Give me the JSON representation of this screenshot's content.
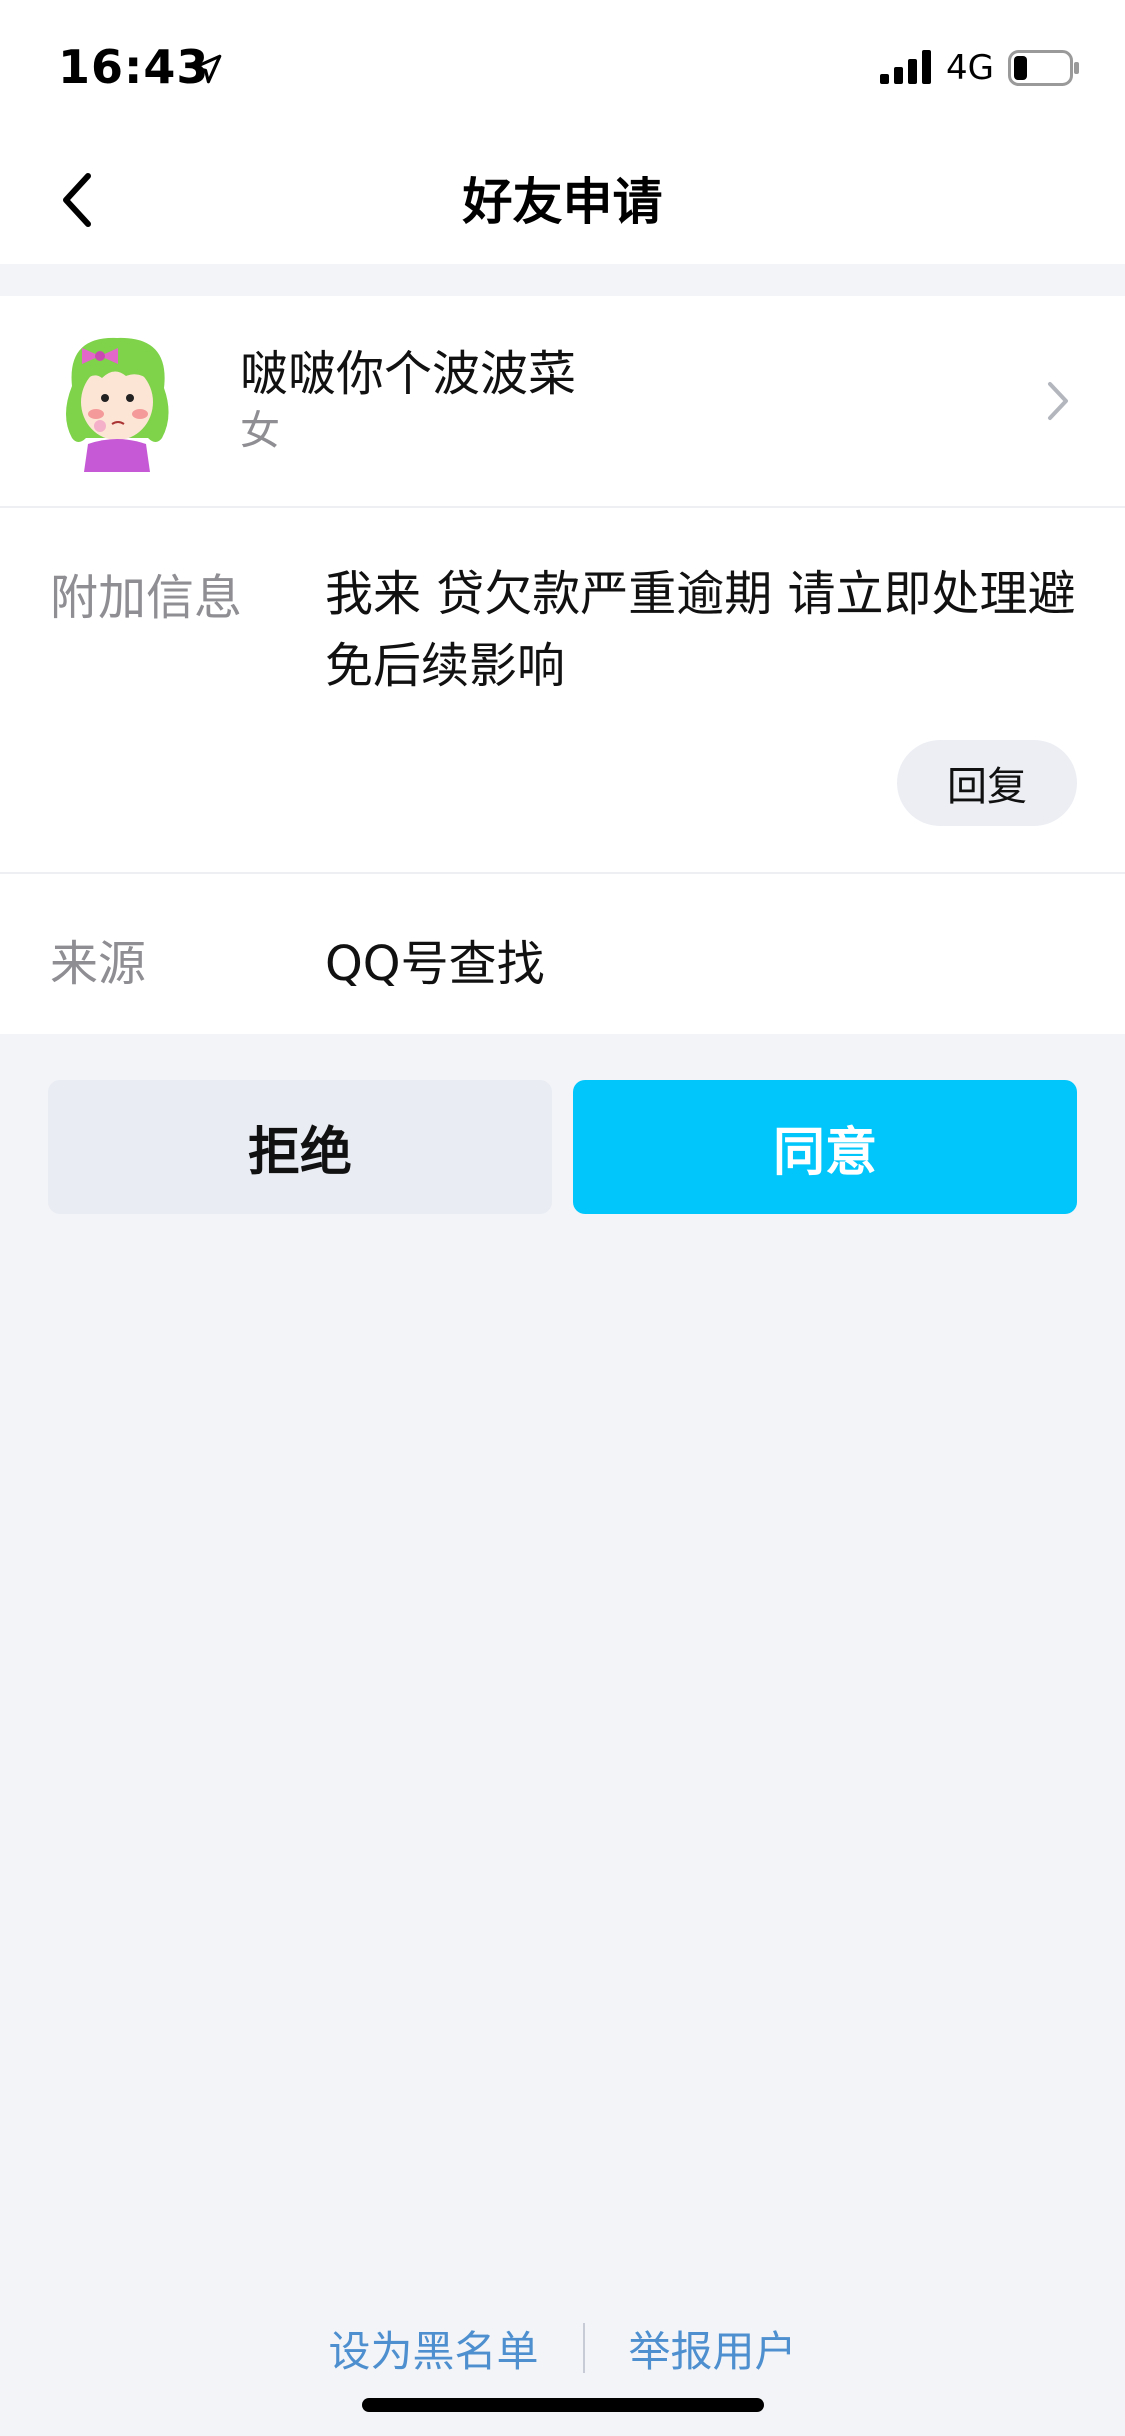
{
  "status_bar": {
    "time": "16:43",
    "network": "4G",
    "battery_level": 0.25
  },
  "nav": {
    "title": "好友申请",
    "back_icon": "chevron-left-icon"
  },
  "profile": {
    "name": "啵啵你个波波菜",
    "gender": "女",
    "avatar_icon": "cartoon-girl-avatar",
    "chevron_icon": "chevron-right-icon"
  },
  "extra_info": {
    "label": "附加信息",
    "message": "我来 贷欠款严重逾期 请立即处理避免后续影响",
    "reply_label": "回复"
  },
  "source": {
    "label": "来源",
    "value": "QQ号查找"
  },
  "actions": {
    "reject_label": "拒绝",
    "accept_label": "同意"
  },
  "footer": {
    "blacklist_label": "设为黑名单",
    "report_label": "举报用户"
  },
  "colors": {
    "accent": "#00c6fb",
    "link": "#4d8fcf",
    "background": "#f3f4f8"
  }
}
